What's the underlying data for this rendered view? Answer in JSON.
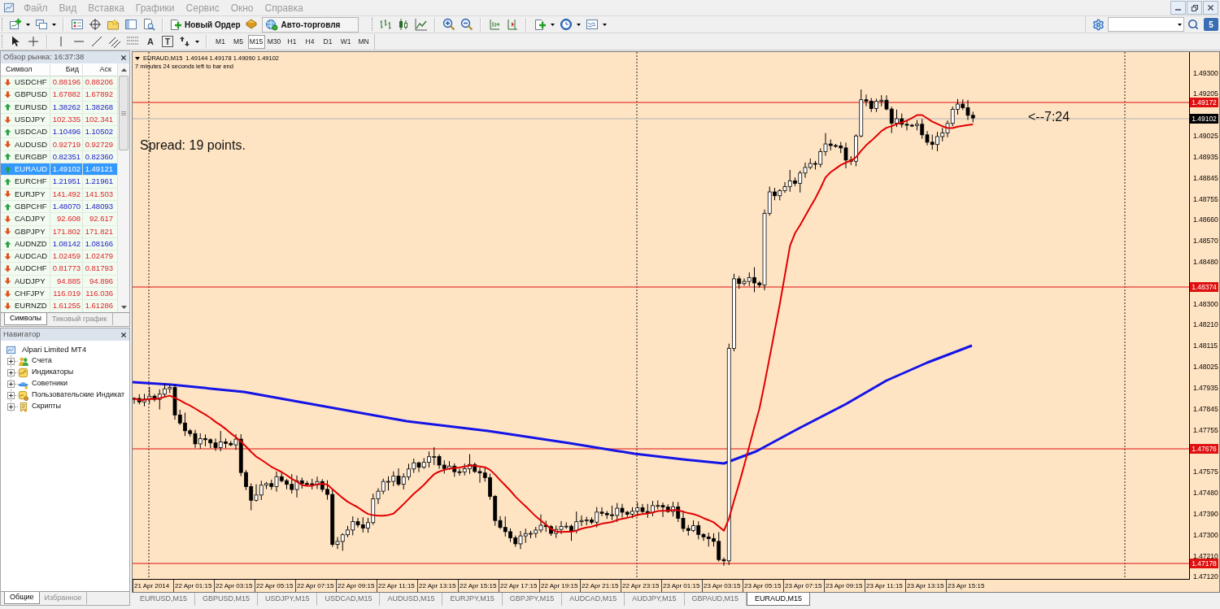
{
  "menu_bar": {
    "items": [
      "Файл",
      "Вид",
      "Вставка",
      "Графики",
      "Сервис",
      "Окно",
      "Справка"
    ]
  },
  "toolbar": {
    "new_order": "Новый Ордер",
    "autotrading": "Авто-торговля",
    "community_badge": "5"
  },
  "line_studies_toolbar": {
    "text_tool": "A",
    "label_tool": "T"
  },
  "timeframes": [
    {
      "label": "M1",
      "selected": false
    },
    {
      "label": "M5",
      "selected": false
    },
    {
      "label": "M15",
      "selected": true
    },
    {
      "label": "M30",
      "selected": false
    },
    {
      "label": "H1",
      "selected": false
    },
    {
      "label": "H4",
      "selected": false
    },
    {
      "label": "D1",
      "selected": false
    },
    {
      "label": "W1",
      "selected": false
    },
    {
      "label": "MN",
      "selected": false
    }
  ],
  "market_watch": {
    "title": "Обзор рынка: 16:37:38",
    "columns": [
      "Символ",
      "Бид",
      "Аск"
    ],
    "rows": [
      {
        "symbol": "USDCHF",
        "bid": "0.88196",
        "ask": "0.88206",
        "kind": "down",
        "selected": false
      },
      {
        "symbol": "GBPUSD",
        "bid": "1.67882",
        "ask": "1.67892",
        "kind": "down",
        "selected": false
      },
      {
        "symbol": "EURUSD",
        "bid": "1.38262",
        "ask": "1.38268",
        "kind": "up",
        "selected": false
      },
      {
        "symbol": "USDJPY",
        "bid": "102.335",
        "ask": "102.341",
        "kind": "down",
        "selected": false
      },
      {
        "symbol": "USDCAD",
        "bid": "1.10496",
        "ask": "1.10502",
        "kind": "up",
        "selected": false
      },
      {
        "symbol": "AUDUSD",
        "bid": "0.92719",
        "ask": "0.92729",
        "kind": "down",
        "selected": false
      },
      {
        "symbol": "EURGBP",
        "bid": "0.82351",
        "ask": "0.82360",
        "kind": "up",
        "selected": false
      },
      {
        "symbol": "EURAUD",
        "bid": "1.49102",
        "ask": "1.49121",
        "kind": "up",
        "selected": true
      },
      {
        "symbol": "EURCHF",
        "bid": "1.21951",
        "ask": "1.21961",
        "kind": "up",
        "selected": false
      },
      {
        "symbol": "EURJPY",
        "bid": "141.492",
        "ask": "141.503",
        "kind": "down",
        "selected": false
      },
      {
        "symbol": "GBPCHF",
        "bid": "1.48070",
        "ask": "1.48093",
        "kind": "up",
        "selected": false
      },
      {
        "symbol": "CADJPY",
        "bid": "92.608",
        "ask": "92.617",
        "kind": "down",
        "selected": false
      },
      {
        "symbol": "GBPJPY",
        "bid": "171.802",
        "ask": "171.821",
        "kind": "down",
        "selected": false
      },
      {
        "symbol": "AUDNZD",
        "bid": "1.08142",
        "ask": "1.08166",
        "kind": "up",
        "selected": false
      },
      {
        "symbol": "AUDCAD",
        "bid": "1.02459",
        "ask": "1.02479",
        "kind": "down",
        "selected": false
      },
      {
        "symbol": "AUDCHF",
        "bid": "0.81773",
        "ask": "0.81793",
        "kind": "down",
        "selected": false
      },
      {
        "symbol": "AUDJPY",
        "bid": "94.885",
        "ask": "94.896",
        "kind": "down",
        "selected": false
      },
      {
        "symbol": "CHFJPY",
        "bid": "116.019",
        "ask": "116.036",
        "kind": "down",
        "selected": false
      },
      {
        "symbol": "EURNZD",
        "bid": "1.61255",
        "ask": "1.61286",
        "kind": "down",
        "selected": false
      }
    ],
    "tabs": [
      {
        "label": "Символы",
        "selected": true
      },
      {
        "label": "Тиковый график",
        "selected": false
      }
    ]
  },
  "navigator": {
    "title": "Навигатор",
    "tree": [
      {
        "label": "Alpari Limited MT4",
        "kind": "terminal",
        "children": [
          {
            "label": "Счета",
            "kind": "accounts",
            "expanded": false
          },
          {
            "label": "Индикаторы",
            "kind": "indicators",
            "expanded": false
          },
          {
            "label": "Советники",
            "kind": "experts",
            "expanded": false
          },
          {
            "label": "Пользовательские Индикат",
            "kind": "custom",
            "expanded": false
          },
          {
            "label": "Скрипты",
            "kind": "scripts",
            "expanded": false
          }
        ]
      }
    ],
    "tabs": [
      {
        "label": "Общие",
        "selected": true
      },
      {
        "label": "Избранное",
        "selected": false
      }
    ]
  },
  "chart": {
    "symbol": "EURAUD,M15",
    "prices": "1.49144 1.49178 1.49090 1.49102",
    "countdown": "7 minutes 24 seconds left to bar end",
    "spread": "Spread: 19 points.",
    "timer": "<--7:24",
    "price_axis": [
      "1.49300",
      "1.49205",
      "1.49025",
      "1.48935",
      "1.48845",
      "1.48755",
      "1.48660",
      "1.48570",
      "1.48480",
      "1.48300",
      "1.48210",
      "1.48115",
      "1.48025",
      "1.47935",
      "1.47845",
      "1.47755",
      "1.47575",
      "1.47480",
      "1.47390",
      "1.47300",
      "1.47210",
      "1.47120"
    ],
    "price_labels": [
      {
        "kind": "level",
        "text": "1.49172"
      },
      {
        "kind": "bid",
        "text": "1.49102"
      },
      {
        "kind": "level",
        "text": "1.48374"
      },
      {
        "kind": "level",
        "text": "1.47676"
      },
      {
        "kind": "level",
        "text": "1.47178"
      }
    ],
    "time_axis": [
      "21 Apr 2014",
      "22 Apr 01:15",
      "22 Apr 03:15",
      "22 Apr 05:15",
      "22 Apr 07:15",
      "22 Apr 09:15",
      "22 Apr 11:15",
      "22 Apr 13:15",
      "22 Apr 15:15",
      "22 Apr 17:15",
      "22 Apr 19:15",
      "22 Apr 21:15",
      "22 Apr 23:15",
      "23 Apr 01:15",
      "23 Apr 03:15",
      "23 Apr 05:15",
      "23 Apr 07:15",
      "23 Apr 09:15",
      "23 Apr 11:15",
      "23 Apr 13:15",
      "23 Apr 15:15"
    ]
  },
  "chart_tabs": [
    {
      "label": "EURUSD,M15",
      "selected": false
    },
    {
      "label": "GBPUSD,M15",
      "selected": false
    },
    {
      "label": "USDJPY,M15",
      "selected": false
    },
    {
      "label": "USDCAD,M15",
      "selected": false
    },
    {
      "label": "AUDUSD,M15",
      "selected": false
    },
    {
      "label": "EURJPY,M15",
      "selected": false
    },
    {
      "label": "GBPJPY,M15",
      "selected": false
    },
    {
      "label": "AUDCAD,M15",
      "selected": false
    },
    {
      "label": "AUDJPY,M15",
      "selected": false
    },
    {
      "label": "GBPAUD,M15",
      "selected": false
    },
    {
      "label": "EURAUD,M15",
      "selected": true
    }
  ]
}
